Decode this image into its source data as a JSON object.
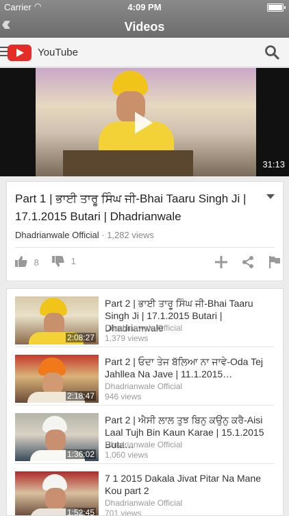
{
  "status": {
    "carrier": "Carrier",
    "time": "4:09 PM"
  },
  "nav": {
    "title": "Videos"
  },
  "youtube": {
    "brand": "YouTube"
  },
  "player": {
    "duration": "31:13"
  },
  "video": {
    "title": "Part 1 | ਭਾਈ ਤਾਰੂ ਸਿੰਘ ਜੀ-Bhai Taaru Singh Ji | 17.1.2015 Butari | Dhadrianwale",
    "channel": "Dhadrianwale Official",
    "separator": "·",
    "views": "1,282 views",
    "likes": "8",
    "dislikes": "1"
  },
  "related": [
    {
      "title": "Part 2 | ਭਾਈ ਤਾਰੂ ਸਿੰਘ ਜੀ-Bhai Taaru Singh Ji | 17.1.2015 Butari | Dhadrianwale",
      "channel": "Dhadrianwale Official",
      "views": "1,379 views",
      "duration": "2:08:27"
    },
    {
      "title": "Part 2 | ਓਦਾ ਤੇਜ ਬੱਲਿਆ ਨਾ ਜਾਵੇ-Oda Tej Jahllea Na Jave | 11.1.2015…",
      "channel": "Dhadrianwale Official",
      "views": "946 views",
      "duration": "2:18:47"
    },
    {
      "title": "Part 2 | ਐਸੀ ਲਾਲ ਤੁਝ ਬਿਨੁ ਕਉਨੁ ਕਰੈ-Aisi Laal Tujh Bin Kaun Karae | 15.1.2015 Buta…",
      "channel": "Dhadrianwale Official",
      "views": "1,060 views",
      "duration": "1:36:02"
    },
    {
      "title": "7 1 2015 Dakala Jivat Pitar Na Mane Kou part 2",
      "channel": "Dhadrianwale Official",
      "views": "701 views",
      "duration": "1:52:45"
    }
  ],
  "colors": {
    "brand": "#e52d27",
    "navbar": "#7a7a7a"
  },
  "icons": [
    "back-icon",
    "menu-icon",
    "youtube-logo-icon",
    "search-icon",
    "play-icon",
    "dropdown-icon",
    "thumb-up-icon",
    "thumb-down-icon",
    "add-icon",
    "share-icon",
    "flag-icon"
  ]
}
